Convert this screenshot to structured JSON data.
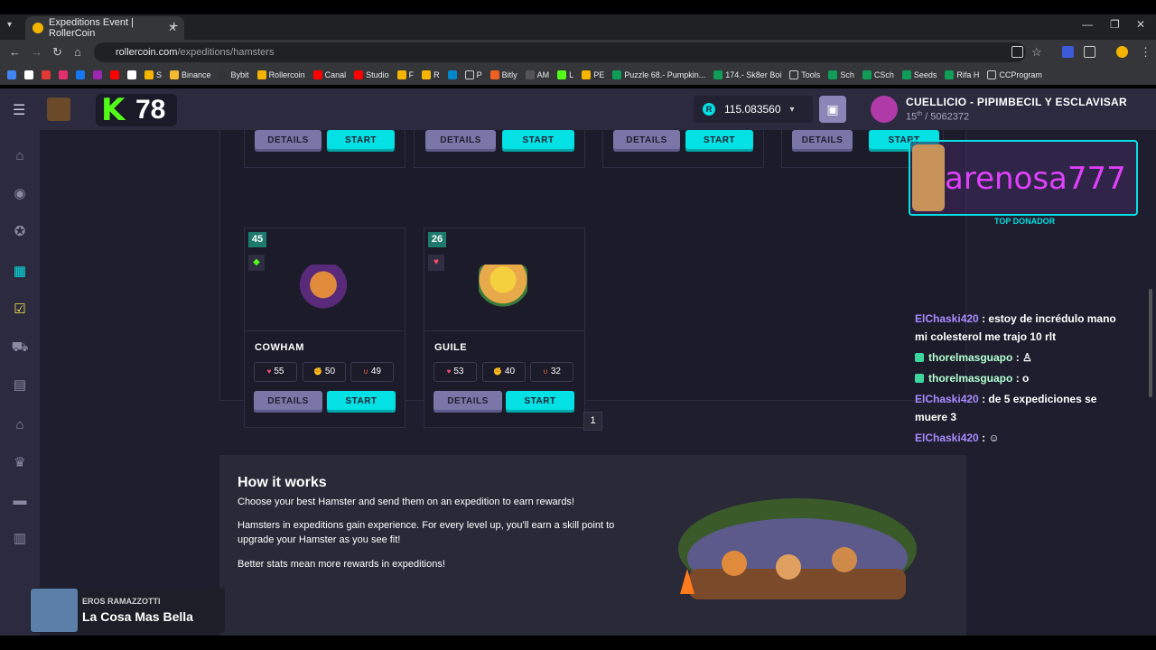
{
  "browser": {
    "tab_title": "Expeditions Event | RollerCoin",
    "url_host": "rollercoin.com",
    "url_path": "/expeditions/hamsters",
    "bookmarks": [
      "S",
      "Binance",
      "Bybit",
      "Rollercoin",
      "Canal",
      "Studio",
      "F",
      "R",
      "P",
      "Bitly",
      "AM",
      "L",
      "PE",
      "Puzzle 68.- Pumpkin...",
      "174.- Sk8er Boi",
      "Tools",
      "Sch",
      "CSch",
      "Seeds",
      "Rifa H",
      "CCProgram"
    ]
  },
  "header": {
    "kick_letter": "K",
    "kick_number": "78",
    "balance": "115.083560",
    "currency_icon": "R",
    "username": "CUELLICIO - PIPIMBECIL Y ESCLAVISAR",
    "rank": "15",
    "rank_suffix": "th",
    "rank_total": "/ 5062372"
  },
  "cards_top_row": {
    "details_label": "DETAILS",
    "start_label": "START"
  },
  "cards": [
    {
      "level": "45",
      "name": "COWHAM",
      "stats": [
        "55",
        "50",
        "49"
      ],
      "details_label": "DETAILS",
      "start_label": "START",
      "type_icon": "diamond-icon"
    },
    {
      "level": "26",
      "name": "GUILE",
      "stats": [
        "53",
        "40",
        "32"
      ],
      "details_label": "DETAILS",
      "start_label": "START",
      "type_icon": "heart-icon"
    }
  ],
  "pagination": {
    "current": "1"
  },
  "how_it_works": {
    "title": "How it works",
    "p1": "Choose your best Hamster and send them on an expedition to earn rewards!",
    "p2": "Hamsters in expeditions gain experience. For every level up, you'll earn a skill point to upgrade your Hamster as you see fit!",
    "p3": "Better stats mean more rewards in expeditions!"
  },
  "stream_overlay": {
    "donor_name": "arenosa777",
    "donor_label": "TOP DONADOR",
    "chat": [
      {
        "user": "ElChaski420",
        "text": ": estoy de incrédulo mano mi colesterol me trajo 10 rlt",
        "badge": false
      },
      {
        "user": "thorelmasguapo",
        "text": ":",
        "badge": true
      },
      {
        "user": "thorelmasguapo",
        "text": ": o",
        "badge": true
      },
      {
        "user": "ElChaski420",
        "text": ": de 5 expediciones se muere 3",
        "badge": false
      },
      {
        "user": "ElChaski420",
        "text": ":",
        "badge": false
      }
    ],
    "music_artist": "EROS RAMAZZOTTI",
    "music_song": "La Cosa Mas Bella"
  },
  "colors": {
    "accent": "#03e1e4",
    "page_bg": "#1f1e2e",
    "kick_green": "#53fc18",
    "donor_pink": "#e040fb"
  }
}
